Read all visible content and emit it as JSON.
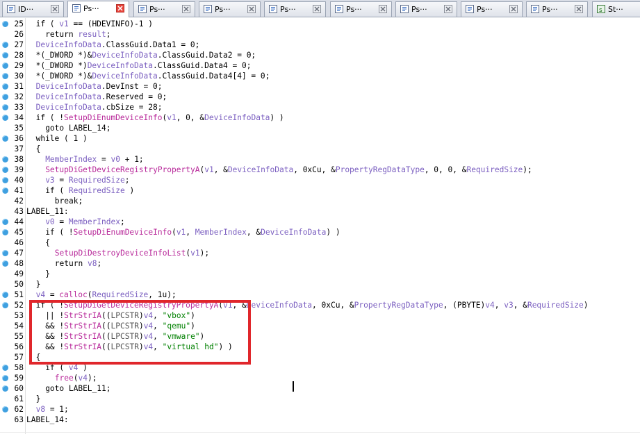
{
  "tabs": [
    {
      "label": "ID···",
      "icon": "ida-view-icon",
      "active": false
    },
    {
      "label": "Ps···",
      "icon": "pseudocode-icon",
      "active": true
    },
    {
      "label": "Ps···",
      "icon": "pseudocode-icon",
      "active": false
    },
    {
      "label": "Ps···",
      "icon": "pseudocode-icon",
      "active": false
    },
    {
      "label": "Ps···",
      "icon": "pseudocode-icon",
      "active": false
    },
    {
      "label": "Ps···",
      "icon": "pseudocode-icon",
      "active": false
    },
    {
      "label": "Ps···",
      "icon": "pseudocode-icon",
      "active": false
    },
    {
      "label": "Ps···",
      "icon": "pseudocode-icon",
      "active": false
    },
    {
      "label": "Ps···",
      "icon": "pseudocode-icon",
      "active": false
    },
    {
      "label": "St···",
      "icon": "strings-icon",
      "active": false
    }
  ],
  "colors": {
    "variable": "#7b5fc0",
    "function": "#b8299a",
    "string": "#008000",
    "highlight_box": "#e0262b"
  },
  "code_lines": [
    {
      "num": "25",
      "bp": true,
      "indent": 1,
      "tokens": [
        [
          "k",
          "if ( "
        ],
        [
          "v",
          "v1"
        ],
        [
          "k",
          " == (HDEVINFO)-1 )"
        ]
      ]
    },
    {
      "num": "26",
      "bp": false,
      "indent": 2,
      "tokens": [
        [
          "k",
          "return "
        ],
        [
          "v",
          "result"
        ],
        [
          "k",
          ";"
        ]
      ]
    },
    {
      "num": "27",
      "bp": true,
      "indent": 1,
      "tokens": [
        [
          "v",
          "DeviceInfoData"
        ],
        [
          "k",
          ".ClassGuid.Data1 = 0;"
        ]
      ]
    },
    {
      "num": "28",
      "bp": true,
      "indent": 1,
      "tokens": [
        [
          "k",
          "*(_DWORD *)&"
        ],
        [
          "v",
          "DeviceInfoData"
        ],
        [
          "k",
          ".ClassGuid.Data2 = 0;"
        ]
      ]
    },
    {
      "num": "29",
      "bp": true,
      "indent": 1,
      "tokens": [
        [
          "k",
          "*(_DWORD *)"
        ],
        [
          "v",
          "DeviceInfoData"
        ],
        [
          "k",
          ".ClassGuid.Data4 = 0;"
        ]
      ]
    },
    {
      "num": "30",
      "bp": true,
      "indent": 1,
      "tokens": [
        [
          "k",
          "*(_DWORD *)&"
        ],
        [
          "v",
          "DeviceInfoData"
        ],
        [
          "k",
          ".ClassGuid.Data4[4] = 0;"
        ]
      ]
    },
    {
      "num": "31",
      "bp": true,
      "indent": 1,
      "tokens": [
        [
          "v",
          "DeviceInfoData"
        ],
        [
          "k",
          ".DevInst = 0;"
        ]
      ]
    },
    {
      "num": "32",
      "bp": true,
      "indent": 1,
      "tokens": [
        [
          "v",
          "DeviceInfoData"
        ],
        [
          "k",
          ".Reserved = 0;"
        ]
      ]
    },
    {
      "num": "33",
      "bp": true,
      "indent": 1,
      "tokens": [
        [
          "v",
          "DeviceInfoData"
        ],
        [
          "k",
          ".cbSize = 28;"
        ]
      ]
    },
    {
      "num": "34",
      "bp": true,
      "indent": 1,
      "tokens": [
        [
          "k",
          "if ( !"
        ],
        [
          "f",
          "SetupDiEnumDeviceInfo"
        ],
        [
          "k",
          "("
        ],
        [
          "v",
          "v1"
        ],
        [
          "k",
          ", 0, &"
        ],
        [
          "v",
          "DeviceInfoData"
        ],
        [
          "k",
          ") )"
        ]
      ]
    },
    {
      "num": "35",
      "bp": false,
      "indent": 2,
      "tokens": [
        [
          "k",
          "goto LABEL_14;"
        ]
      ]
    },
    {
      "num": "36",
      "bp": true,
      "indent": 1,
      "tokens": [
        [
          "k",
          "while ( 1 )"
        ]
      ]
    },
    {
      "num": "37",
      "bp": false,
      "indent": 1,
      "tokens": [
        [
          "k",
          "{"
        ]
      ]
    },
    {
      "num": "38",
      "bp": true,
      "indent": 2,
      "tokens": [
        [
          "v",
          "MemberIndex"
        ],
        [
          "k",
          " = "
        ],
        [
          "v",
          "v0"
        ],
        [
          "k",
          " + 1;"
        ]
      ]
    },
    {
      "num": "39",
      "bp": true,
      "indent": 2,
      "tokens": [
        [
          "f",
          "SetupDiGetDeviceRegistryPropertyA"
        ],
        [
          "k",
          "("
        ],
        [
          "v",
          "v1"
        ],
        [
          "k",
          ", &"
        ],
        [
          "v",
          "DeviceInfoData"
        ],
        [
          "k",
          ", 0xCu, &"
        ],
        [
          "v",
          "PropertyRegDataType"
        ],
        [
          "k",
          ", 0, 0, &"
        ],
        [
          "v",
          "RequiredSize"
        ],
        [
          "k",
          ");"
        ]
      ]
    },
    {
      "num": "40",
      "bp": true,
      "indent": 2,
      "tokens": [
        [
          "v",
          "v3"
        ],
        [
          "k",
          " = "
        ],
        [
          "v",
          "RequiredSize"
        ],
        [
          "k",
          ";"
        ]
      ]
    },
    {
      "num": "41",
      "bp": true,
      "indent": 2,
      "tokens": [
        [
          "k",
          "if ( "
        ],
        [
          "v",
          "RequiredSize"
        ],
        [
          "k",
          " )"
        ]
      ]
    },
    {
      "num": "42",
      "bp": false,
      "indent": 3,
      "tokens": [
        [
          "k",
          "break;"
        ]
      ]
    },
    {
      "num": "43",
      "bp": false,
      "indent": 0,
      "tokens": [
        [
          "k",
          "LABEL_11:"
        ]
      ]
    },
    {
      "num": "44",
      "bp": true,
      "indent": 2,
      "tokens": [
        [
          "v",
          "v0"
        ],
        [
          "k",
          " = "
        ],
        [
          "v",
          "MemberIndex"
        ],
        [
          "k",
          ";"
        ]
      ]
    },
    {
      "num": "45",
      "bp": true,
      "indent": 2,
      "tokens": [
        [
          "k",
          "if ( !"
        ],
        [
          "f",
          "SetupDiEnumDeviceInfo"
        ],
        [
          "k",
          "("
        ],
        [
          "v",
          "v1"
        ],
        [
          "k",
          ", "
        ],
        [
          "v",
          "MemberIndex"
        ],
        [
          "k",
          ", &"
        ],
        [
          "v",
          "DeviceInfoData"
        ],
        [
          "k",
          ") )"
        ]
      ]
    },
    {
      "num": "46",
      "bp": false,
      "indent": 2,
      "tokens": [
        [
          "k",
          "{"
        ]
      ]
    },
    {
      "num": "47",
      "bp": true,
      "indent": 3,
      "tokens": [
        [
          "f",
          "SetupDiDestroyDeviceInfoList"
        ],
        [
          "k",
          "("
        ],
        [
          "v",
          "v1"
        ],
        [
          "k",
          ");"
        ]
      ]
    },
    {
      "num": "48",
      "bp": true,
      "indent": 3,
      "tokens": [
        [
          "k",
          "return "
        ],
        [
          "v",
          "v8"
        ],
        [
          "k",
          ";"
        ]
      ]
    },
    {
      "num": "49",
      "bp": false,
      "indent": 2,
      "tokens": [
        [
          "k",
          "}"
        ]
      ]
    },
    {
      "num": "50",
      "bp": false,
      "indent": 1,
      "tokens": [
        [
          "k",
          "}"
        ]
      ]
    },
    {
      "num": "51",
      "bp": true,
      "indent": 1,
      "tokens": [
        [
          "v",
          "v4"
        ],
        [
          "k",
          " = "
        ],
        [
          "f",
          "calloc"
        ],
        [
          "k",
          "("
        ],
        [
          "v",
          "RequiredSize"
        ],
        [
          "k",
          ", 1u);"
        ]
      ]
    },
    {
      "num": "52",
      "bp": true,
      "indent": 1,
      "tokens": [
        [
          "k",
          "if ( !"
        ],
        [
          "f",
          "SetupDiGetDeviceRegistryPropertyA"
        ],
        [
          "k",
          "("
        ],
        [
          "v",
          "v1"
        ],
        [
          "k",
          ", &"
        ],
        [
          "v",
          "DeviceInfoData"
        ],
        [
          "k",
          ", 0xCu, &"
        ],
        [
          "v",
          "PropertyRegDataType"
        ],
        [
          "k",
          ", (PBYTE)"
        ],
        [
          "v",
          "v4"
        ],
        [
          "k",
          ", "
        ],
        [
          "v",
          "v3"
        ],
        [
          "k",
          ", &"
        ],
        [
          "v",
          "RequiredSize"
        ],
        [
          "k",
          ")"
        ]
      ]
    },
    {
      "num": "53",
      "bp": false,
      "indent": 2,
      "tokens": [
        [
          "k",
          "|| !"
        ],
        [
          "f",
          "StrStrIA"
        ],
        [
          "k",
          "(("
        ],
        [
          "t",
          "LPCSTR"
        ],
        [
          "k",
          ")"
        ],
        [
          "v",
          "v4"
        ],
        [
          "k",
          ", "
        ],
        [
          "s",
          "\"vbox\""
        ],
        [
          "k",
          ")"
        ]
      ]
    },
    {
      "num": "54",
      "bp": false,
      "indent": 2,
      "tokens": [
        [
          "k",
          "&& !"
        ],
        [
          "f",
          "StrStrIA"
        ],
        [
          "k",
          "(("
        ],
        [
          "t",
          "LPCSTR"
        ],
        [
          "k",
          ")"
        ],
        [
          "v",
          "v4"
        ],
        [
          "k",
          ", "
        ],
        [
          "s",
          "\"qemu\""
        ],
        [
          "k",
          ")"
        ]
      ]
    },
    {
      "num": "55",
      "bp": false,
      "indent": 2,
      "tokens": [
        [
          "k",
          "&& !"
        ],
        [
          "f",
          "StrStrIA"
        ],
        [
          "k",
          "(("
        ],
        [
          "t",
          "LPCSTR"
        ],
        [
          "k",
          ")"
        ],
        [
          "v",
          "v4"
        ],
        [
          "k",
          ", "
        ],
        [
          "s",
          "\"vmware\""
        ],
        [
          "k",
          ")"
        ]
      ]
    },
    {
      "num": "56",
      "bp": false,
      "indent": 2,
      "tokens": [
        [
          "k",
          "&& !"
        ],
        [
          "f",
          "StrStrIA"
        ],
        [
          "k",
          "(("
        ],
        [
          "t",
          "LPCSTR"
        ],
        [
          "k",
          ")"
        ],
        [
          "v",
          "v4"
        ],
        [
          "k",
          ", "
        ],
        [
          "s",
          "\"virtual hd\""
        ],
        [
          "k",
          ") )"
        ]
      ]
    },
    {
      "num": "57",
      "bp": false,
      "indent": 1,
      "tokens": [
        [
          "k",
          "{"
        ]
      ]
    },
    {
      "num": "58",
      "bp": true,
      "indent": 2,
      "tokens": [
        [
          "k",
          "if ( "
        ],
        [
          "v",
          "v4"
        ],
        [
          "k",
          " )"
        ]
      ]
    },
    {
      "num": "59",
      "bp": true,
      "indent": 3,
      "tokens": [
        [
          "f",
          "free"
        ],
        [
          "k",
          "("
        ],
        [
          "v",
          "v4"
        ],
        [
          "k",
          ");"
        ]
      ]
    },
    {
      "num": "60",
      "bp": true,
      "indent": 2,
      "tokens": [
        [
          "k",
          "goto LABEL_11;"
        ]
      ]
    },
    {
      "num": "61",
      "bp": false,
      "indent": 1,
      "tokens": [
        [
          "k",
          "}"
        ]
      ]
    },
    {
      "num": "62",
      "bp": true,
      "indent": 1,
      "tokens": [
        [
          "v",
          "v8"
        ],
        [
          "k",
          " = 1;"
        ]
      ]
    },
    {
      "num": "63",
      "bp": false,
      "indent": 0,
      "tokens": [
        [
          "k",
          "LABEL_14:"
        ]
      ]
    }
  ]
}
